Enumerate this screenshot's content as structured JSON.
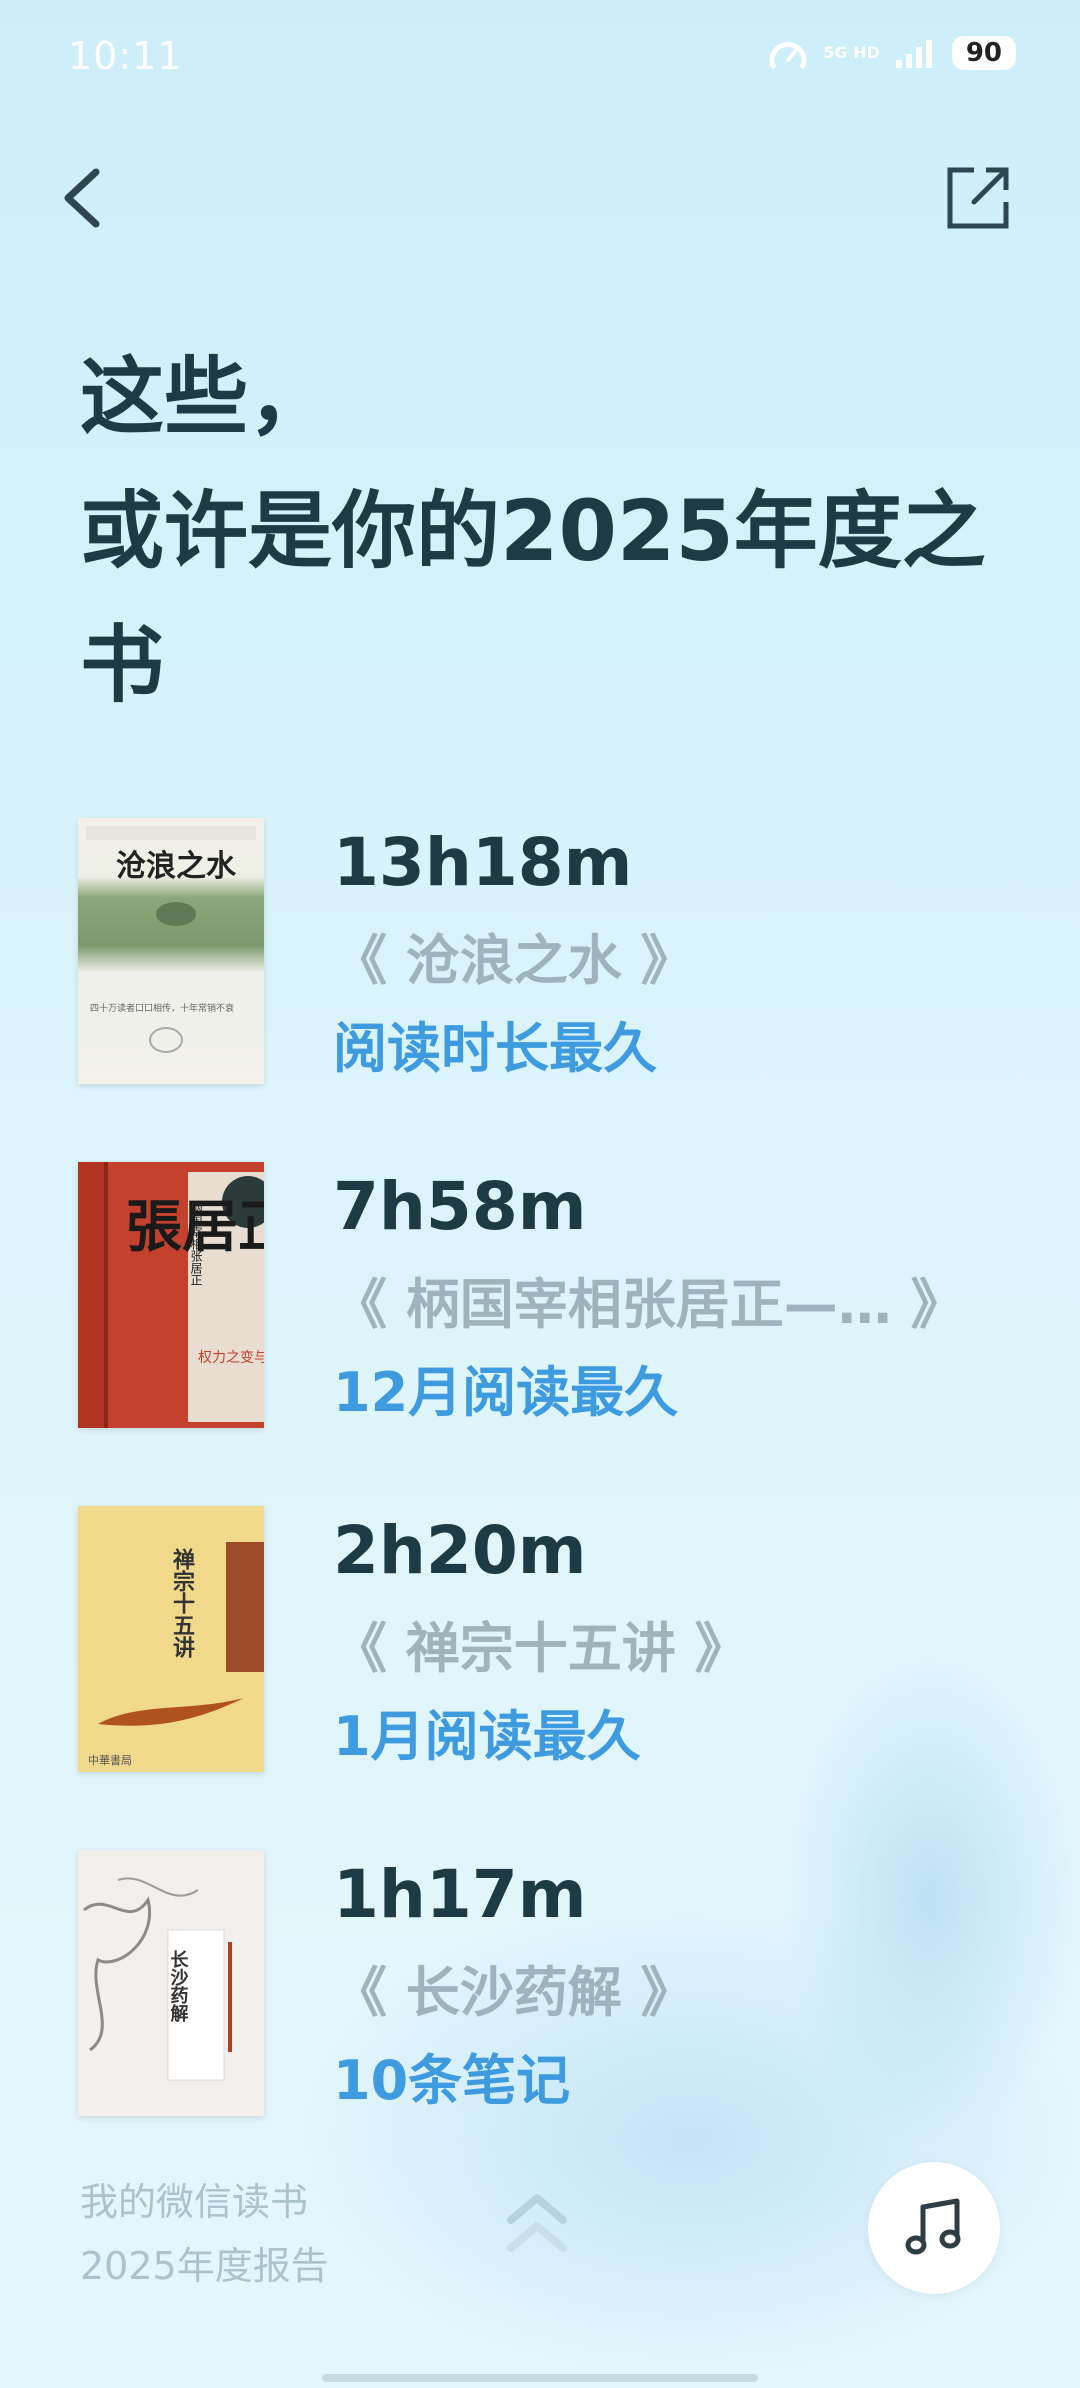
{
  "status": {
    "time": "10:11",
    "network": "5G HD",
    "battery": "90"
  },
  "headline": {
    "line1": "这些，",
    "line2": "或许是你的2025年度之",
    "line3": "书"
  },
  "books": [
    {
      "time": "13h18m",
      "title": "《 沧浪之水 》",
      "tag": "阅读时长最久",
      "cover_title": "沧浪之水",
      "cover_subtitle": "四十万读者口口相传，十年常销不衰"
    },
    {
      "time": "7h58m",
      "title": "《 柄国宰相张居正—…  》",
      "tag": "12月阅读最久",
      "cover_title": "張居正",
      "cover_subtitle": "柄国宰相张居正",
      "cover_note": "权力之变与改革人生"
    },
    {
      "time": "2h20m",
      "title": "《 禅宗十五讲 》",
      "tag": "1月阅读最久",
      "cover_title": "禅宗十五讲"
    },
    {
      "time": "1h17m",
      "title": "《 长沙药解 》",
      "tag": "10条笔记",
      "cover_title": "长沙药解"
    }
  ],
  "footer": {
    "line1": "我的微信读书",
    "line2": "2025年度报告"
  },
  "colors": {
    "accent": "#3e9be0",
    "heading": "#1e3a44",
    "muted": "#9eb3bb"
  },
  "icons": {
    "back": "chevron-left-icon",
    "share": "share-icon",
    "up": "double-chevron-up-icon",
    "music": "music-note-icon"
  }
}
